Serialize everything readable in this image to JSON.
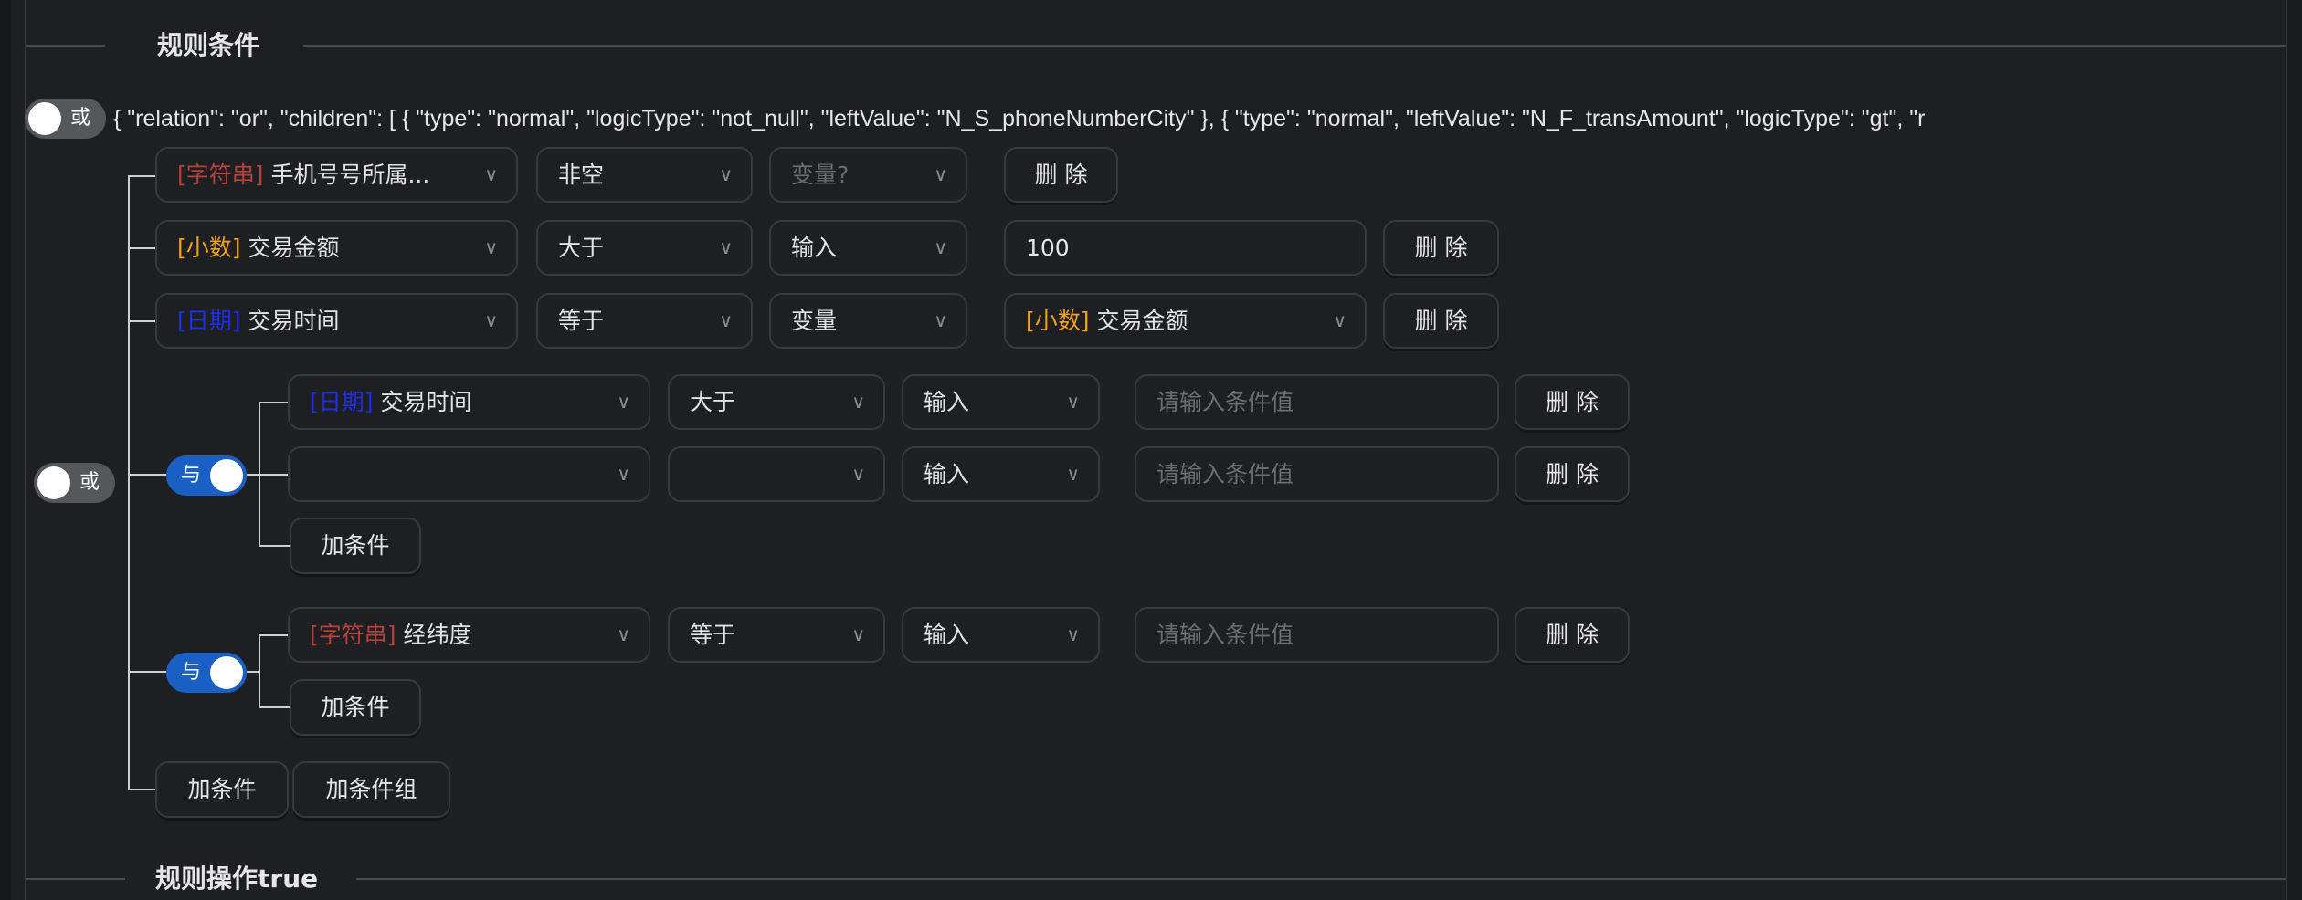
{
  "sections": {
    "conditions_title": "规则条件",
    "actions_title": "规则操作true"
  },
  "root": {
    "toggle_label": "或",
    "toggle_on": false,
    "json_preview": "{ \"relation\": \"or\", \"children\": [ { \"type\": \"normal\", \"logicType\": \"not_null\", \"leftValue\": \"N_S_phoneNumberCity\" }, { \"type\": \"normal\", \"leftValue\": \"N_F_transAmount\", \"logicType\": \"gt\", \"r"
  },
  "tree_toggle": {
    "label": "或",
    "on": false
  },
  "rows": [
    {
      "field_tag": "[字符串]",
      "field_tag_color": "#b8413a",
      "field": "手机号号所属...",
      "operator": "非空",
      "value_type": "变量?",
      "value_type_placeholder": true,
      "delete": "删 除"
    },
    {
      "field_tag": "[小数]",
      "field_tag_color": "#f0a41a",
      "field": "交易金额",
      "operator": "大于",
      "value_type": "输入",
      "value": "100",
      "delete": "删 除"
    },
    {
      "field_tag": "[日期]",
      "field_tag_color": "#1f2fe6",
      "field": "交易时间",
      "operator": "等于",
      "value_type": "变量",
      "value_tag": "[小数]",
      "value_field": "交易金额",
      "delete": "删 除"
    }
  ],
  "groups": [
    {
      "toggle_label": "与",
      "toggle_on": true,
      "rows": [
        {
          "field_tag": "[日期]",
          "field": "交易时间",
          "operator": "大于",
          "value_type": "输入",
          "value_placeholder": "请输入条件值",
          "delete": "删 除"
        },
        {
          "field_tag": "",
          "field": "",
          "operator": "",
          "value_type": "输入",
          "value_placeholder": "请输入条件值",
          "delete": "删 除"
        }
      ],
      "add_condition": "加条件"
    },
    {
      "toggle_label": "与",
      "toggle_on": true,
      "rows": [
        {
          "field_tag": "[字符串]",
          "field": "经纬度",
          "operator": "等于",
          "value_type": "输入",
          "value_placeholder": "请输入条件值",
          "delete": "删 除"
        }
      ],
      "add_condition": "加条件"
    }
  ],
  "footer": {
    "add_condition": "加条件",
    "add_group": "加条件组"
  },
  "icons": {
    "chevron": "chevron-down-icon"
  },
  "colors": {
    "background": "#1e1f22",
    "toggle_on": "#1a5fc4",
    "toggle_off": "#55575b",
    "string_tag": "#b8413a",
    "decimal_tag": "#f0a41a",
    "date_tag": "#1f2fe6"
  }
}
